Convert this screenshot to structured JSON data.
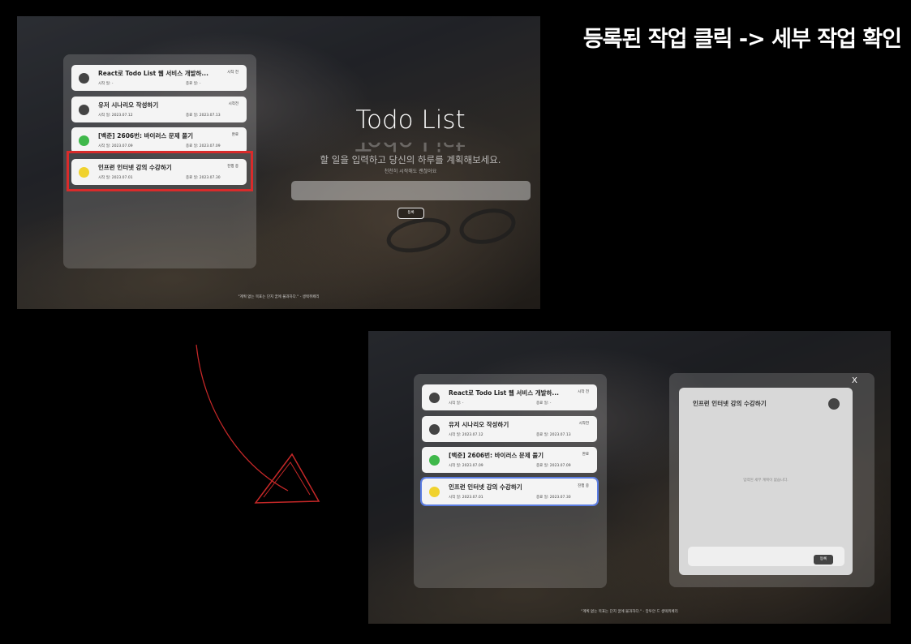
{
  "caption": "등록된 작업 클릭 -> 세부 작업 확인",
  "colors": {
    "accent": "#d92b2b",
    "selected_border": "#5b7de3",
    "status_gray": "#444444",
    "status_green": "#3fb84a",
    "status_yellow": "#f0d22e"
  },
  "tasks": [
    {
      "title": "React로 Todo List 웹 서비스 개발하...",
      "status": "시작 전",
      "start": "시작 일: -",
      "end": "종료 일: -",
      "dot": "#444444"
    },
    {
      "title": "유저 시나리오 작성하기",
      "status": "시작전",
      "start": "시작 일: 2023.07.12",
      "end": "종료 일: 2023.07.13",
      "dot": "#444444"
    },
    {
      "title": "[백준] 2606번: 바이러스 문제 풀기",
      "status": "완료",
      "start": "시작 일: 2023.07.09",
      "end": "종료 일: 2023.07.09",
      "dot": "#3fb84a"
    },
    {
      "title": "인프런 인터넷 강의 수강하기",
      "status": "진행 중",
      "start": "시작 일: 2023.07.01",
      "end": "종료 일: 2023.07.30",
      "dot": "#f0d22e"
    }
  ],
  "main": {
    "title": "Todo List",
    "subtitle": "할 일을 입력하고 당신의 하루를 계획해보세요.",
    "subtitle2": "천천히 시작해도 괜찮아요",
    "register_label": "등록"
  },
  "quote": "\"계획 없는 목표는 단지 꿈에 불과하다.\" - 생텍쥐페리",
  "quote_short": "\"계획 없는 목표는 단지 꿈에 불과하다.\" - 앙투안 드 생텍쥐페리",
  "detail": {
    "close_label": "X",
    "title": "인프런 인터넷 강의 수강하기",
    "empty_text": "입력된 세부 계획이 없습니다.",
    "register_label": "등록"
  }
}
